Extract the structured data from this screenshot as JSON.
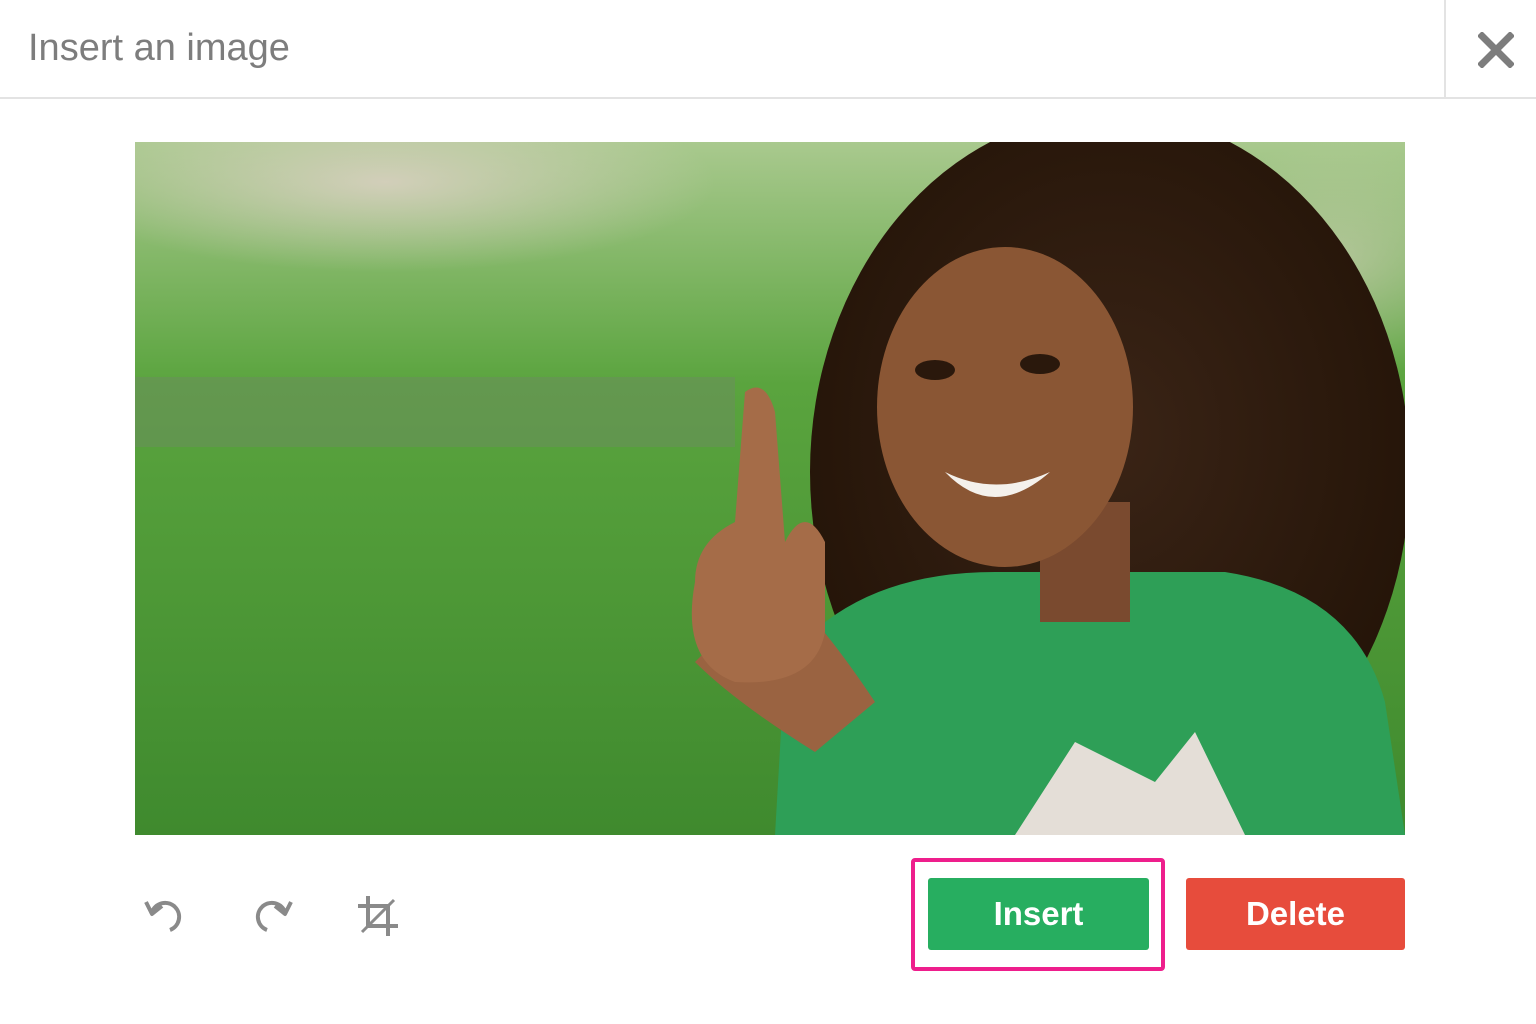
{
  "dialog": {
    "title": "Insert an image",
    "close_icon": "close-icon"
  },
  "preview": {
    "icon": "photo-preview"
  },
  "toolbar": {
    "undo_icon": "undo-icon",
    "redo_icon": "redo-icon",
    "crop_icon": "crop-icon"
  },
  "actions": {
    "insert_label": "Insert",
    "delete_label": "Delete"
  },
  "colors": {
    "insert": "#27ae60",
    "delete": "#e74c3c",
    "highlight": "#ee1e8c",
    "icon": "#8a8a8a"
  }
}
